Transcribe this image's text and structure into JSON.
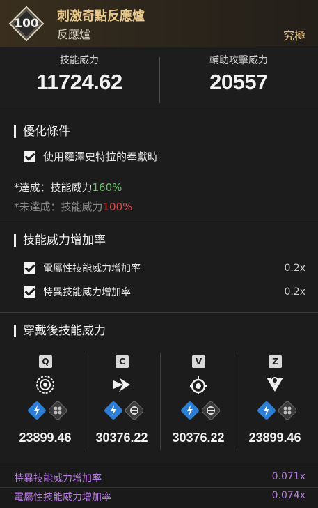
{
  "header": {
    "level": "100",
    "title": "刺激奇點反應爐",
    "subtitle": "反應爐",
    "rarity": "究極"
  },
  "stats": {
    "skill_power_label": "技能威力",
    "skill_power_value": "11724.62",
    "sub_attack_label": "輔助攻擊威力",
    "sub_attack_value": "20557"
  },
  "optimization": {
    "title": "優化條件",
    "condition": "使用羅澤史特拉的奉獻時",
    "achieved_prefix": "*達成：技能威力",
    "achieved_value": "160%",
    "not_achieved_prefix": "*未達成：技能威力",
    "not_achieved_value": "100%"
  },
  "modifiers": {
    "title": "技能威力增加率",
    "rows": [
      {
        "label": "電屬性技能威力增加率",
        "value": "0.2x"
      },
      {
        "label": "特異技能威力增加率",
        "value": "0.2x"
      }
    ]
  },
  "equipped": {
    "title": "穿戴後技能威力",
    "skills": [
      {
        "key": "Q",
        "value": "23899.46",
        "icon": "burst-icon"
      },
      {
        "key": "C",
        "value": "30376.22",
        "icon": "dash-icon"
      },
      {
        "key": "V",
        "value": "30376.22",
        "icon": "bomb-icon"
      },
      {
        "key": "Z",
        "value": "23899.46",
        "icon": "blast-icon"
      }
    ]
  },
  "footer": {
    "rows": [
      {
        "label": "特異技能威力增加率",
        "value": "0.071x"
      },
      {
        "label": "電屬性技能威力增加率",
        "value": "0.074x"
      }
    ]
  },
  "colors": {
    "accent_gold": "#e8c98a",
    "achieved_green": "#6ac46a",
    "not_achieved_red": "#d94a4a",
    "footer_purple": "#b57be0",
    "element_blue": "#2d7fd6"
  }
}
